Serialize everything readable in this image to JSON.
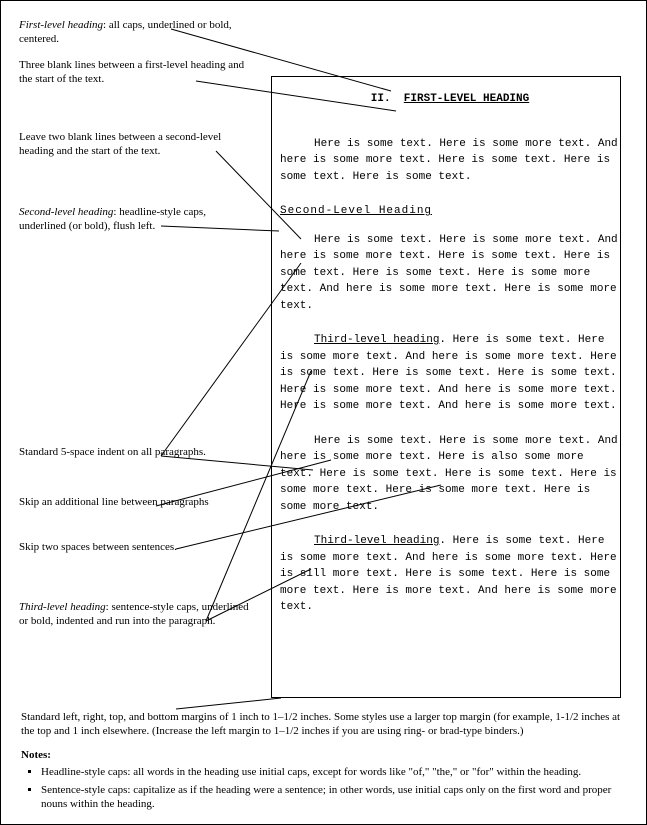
{
  "callouts": {
    "c1": {
      "label": "First-level heading",
      "text": ": all caps, underlined or bold, centered."
    },
    "c2": "Three blank lines between a first-level heading and the start of the text.",
    "c3": "Leave two blank lines between a second-level heading and the start of the text.",
    "c4": {
      "label": "Second-level heading",
      "text": ": headline-style caps, underlined (or bold), flush left."
    },
    "c5": "Standard 5-space indent on all paragraphs.",
    "c6": "Skip an additional line between paragraphs",
    "c7": "Skip two spaces between sentences.",
    "c8": {
      "label": "Third-level heading",
      "text": ": sentence-style caps, underlined or bold, indented and run into the paragraph."
    }
  },
  "page": {
    "h1_prefix": "II.",
    "h1_text": "FIRST-LEVEL HEADING",
    "p1": "Here is some text.  Here is some more text.  And here is some more text.  Here is some text.  Here is some text.  Here is some text.",
    "h2": "Second-Level  Heading",
    "p2": "Here is some text.  Here is some more text.  And here is some more text.  Here is some text.  Here is some text.  Here is some text.  Here is some more text.  And here is some more text.  Here is some more text.",
    "p3_runin": "Third-level heading",
    "p3": ".  Here is some text.  Here is some more text.  And here is some more text.   Here is some text.  Here is some text.  Here is some text.  Here is some more text.  And here is some more text.  Here is some more text.  And here is some more text.",
    "p4": "Here is some text.  Here is some more text.  And here is some more text.  Here is also some more text.  Here is some text.  Here is some text.  Here is some more text.  Here is some more text.  Here is some more text.",
    "p5_runin": "Third-level heading",
    "p5": ".  Here is some text.  Here is some more text.  And here is some more text.  Here is sill more text.  Here is some text.  Here is some more text.  Here is more text.  And here is some more text."
  },
  "bottom": {
    "margins": "Standard left, right, top, and bottom margins of 1 inch to 1–1/2 inches. Some styles use a larger top margin (for example, 1-1/2 inches at the top and 1 inch elsewhere. (Increase the left margin to 1–1/2 inches if you are using ring- or brad-type binders.)",
    "notes_title": "Notes:",
    "note1": "Headline-style caps: all words in the heading use initial caps, except for words like \"of,\" \"the,\" or \"for\" within the heading.",
    "note2": "Sentence-style caps: capitalize as if the heading were a sentence; in other words, use initial caps only on the first word and proper nouns within the heading."
  }
}
